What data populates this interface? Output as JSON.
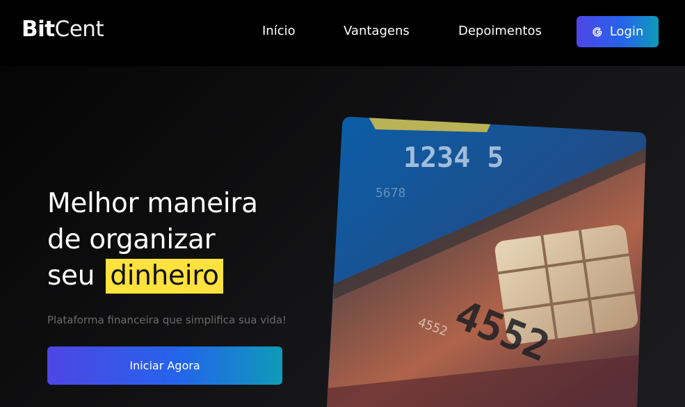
{
  "brand": {
    "bold": "Bit",
    "light": "Cent"
  },
  "nav": {
    "inicio": "Início",
    "vantagens": "Vantagens",
    "depoimentos": "Depoimentos",
    "login": "Login"
  },
  "hero": {
    "line1_highlight": "Melhor",
    "line1_rest": " maneira",
    "line2": "de organizar",
    "line3_start": "seu ",
    "line3_highlight": "dinheiro",
    "subtitle": "Plataforma financeira que simplifica sua vida!",
    "cta": "Iniciar Agora"
  },
  "card_numbers": {
    "top": "1234 5",
    "small": "5678",
    "middle": "4552",
    "bottom": "4552"
  },
  "colors": {
    "accent_gradient_start": "#4f46e5",
    "accent_gradient_end": "#0e9bb8",
    "underline_purple": "#9b5cf6",
    "highlight_yellow": "#ffe23d"
  }
}
